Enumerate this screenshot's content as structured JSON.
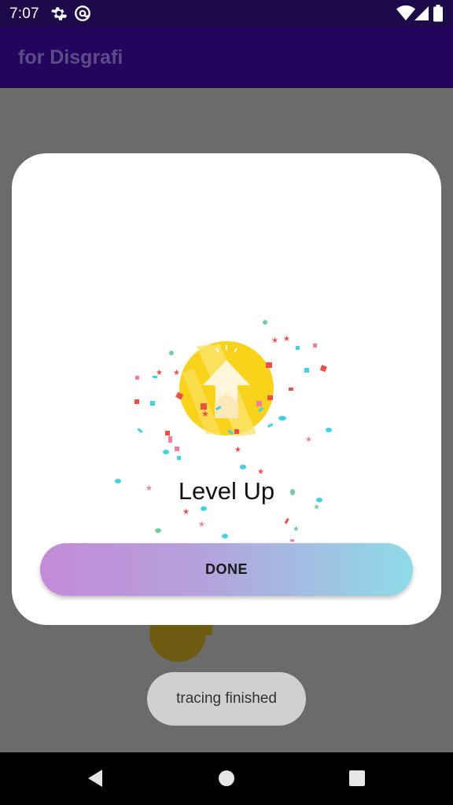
{
  "status_bar": {
    "time": "7:07",
    "left_icons": [
      "gear-icon",
      "at-sign-icon"
    ],
    "right_icons": [
      "wifi-icon",
      "signal-icon",
      "battery-icon"
    ]
  },
  "app_bar": {
    "title": "for Disgrafi"
  },
  "dialog": {
    "title": "Level Up",
    "badge_icon": "level-up-arrow-icon",
    "done_label": "DONE"
  },
  "toast": {
    "text": "tracing finished"
  },
  "nav_bar": {
    "icons": [
      "back-icon",
      "home-icon",
      "recents-icon"
    ]
  },
  "colors": {
    "status_bar": "#1d0a4a",
    "app_bar": "#23055e",
    "scrim": "#6b6b6b",
    "coin": "#f9d21a",
    "button_gradient_start": "#c48ad8",
    "button_gradient_end": "#8fdbe8"
  }
}
